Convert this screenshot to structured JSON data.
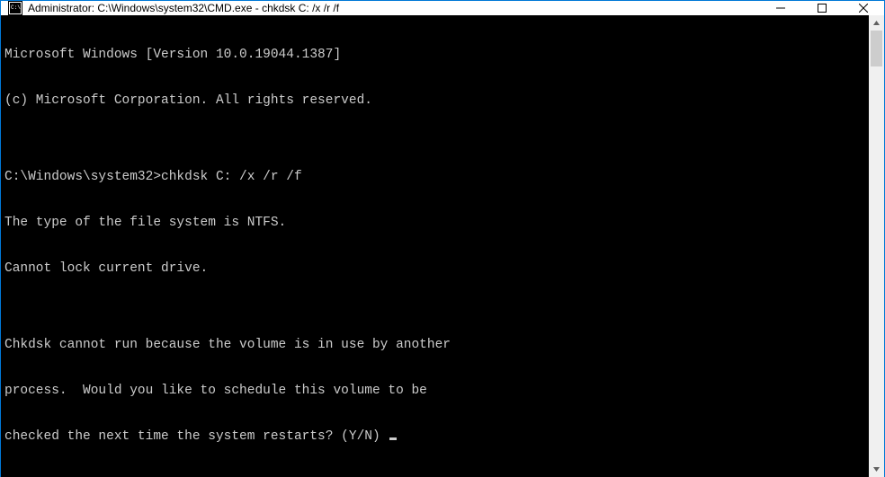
{
  "titlebar": {
    "title": "Administrator: C:\\Windows\\system32\\CMD.exe - chkdsk  C: /x /r /f"
  },
  "console": {
    "line1": "Microsoft Windows [Version 10.0.19044.1387]",
    "line2": "(c) Microsoft Corporation. All rights reserved.",
    "blank1": "",
    "prompt": "C:\\Windows\\system32>",
    "command": "chkdsk C: /x /r /f",
    "out1": "The type of the file system is NTFS.",
    "out2": "Cannot lock current drive.",
    "blank2": "",
    "out3": "Chkdsk cannot run because the volume is in use by another",
    "out4": "process.  Would you like to schedule this volume to be",
    "out5": "checked the next time the system restarts? (Y/N) "
  }
}
